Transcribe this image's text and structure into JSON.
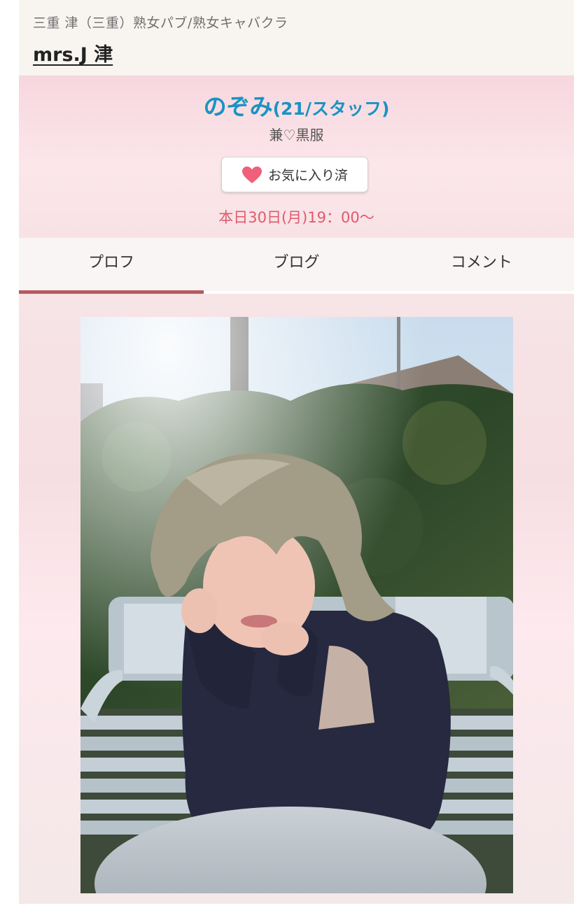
{
  "header": {
    "category": "三重 津（三重）熟女パブ/熟女キャバクラ",
    "shop_name": "mrs.J 津"
  },
  "profile": {
    "name": "のぞみ",
    "meta": "(21/スタッフ)",
    "type": "兼♡黒服",
    "favorite_label": "お気に入り済",
    "schedule": "本日30日(月)19：00〜"
  },
  "tabs": [
    {
      "label": "プロフ",
      "active": true
    },
    {
      "label": "ブログ",
      "active": false
    },
    {
      "label": "コメント",
      "active": false
    }
  ],
  "colors": {
    "name": "#1a93c2",
    "schedule": "#e05a6c",
    "heart": "#f0607a",
    "active_tab": "#b65a5f"
  },
  "icons": {
    "favorite": "heart-icon"
  }
}
